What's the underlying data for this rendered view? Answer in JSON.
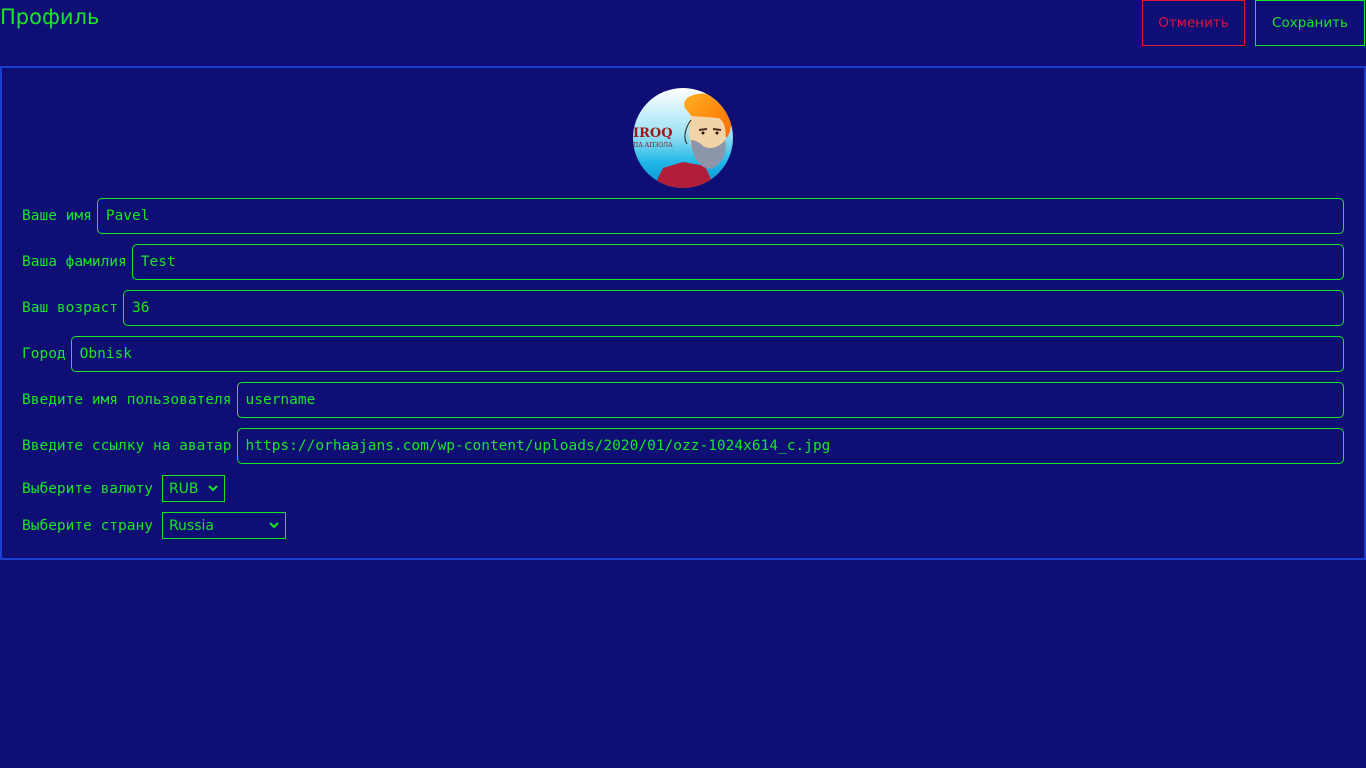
{
  "header": {
    "title": "Профиль",
    "cancel_label": "Отменить",
    "save_label": "Сохранить"
  },
  "avatar": {
    "logo_text": "IROQ",
    "logo_subtext": "ПА АПЗОЛА"
  },
  "form": {
    "first_name": {
      "label": "Ваше имя",
      "value": "Pavel"
    },
    "last_name": {
      "label": "Ваша фамилия",
      "value": "Test"
    },
    "age": {
      "label": "Ваш возраст",
      "value": "36"
    },
    "city": {
      "label": "Город",
      "value": "Obnisk"
    },
    "username": {
      "label": "Введите имя пользователя",
      "value": "username"
    },
    "avatar_url": {
      "label": "Введите ссылку на аватар",
      "value": "https://orhaajans.com/wp-content/uploads/2020/01/ozz-1024x614_c.jpg"
    },
    "currency": {
      "label": "Выберите валюту",
      "selected": "RUB"
    },
    "country": {
      "label": "Выберите страну",
      "selected": "Russia"
    }
  },
  "colors": {
    "background": "#0e0e74",
    "accent": "#19e626",
    "danger": "#e0143c",
    "panel_border": "#1a3fcf"
  }
}
